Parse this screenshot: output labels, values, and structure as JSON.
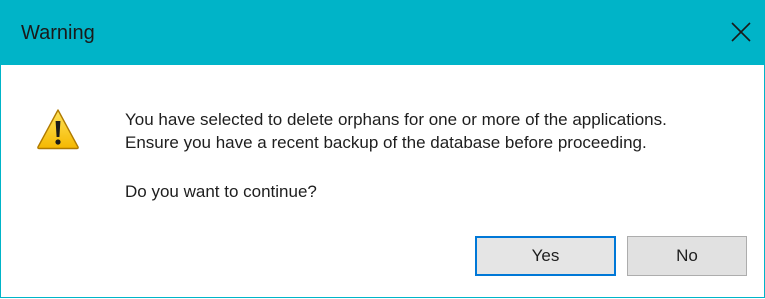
{
  "window": {
    "title": "Warning",
    "close_icon": "close-icon",
    "titlebar_color": "#00b4c8"
  },
  "message": {
    "icon": "warning-triangle-icon",
    "line1": "You have selected to delete orphans for one or more of the applications.",
    "line2": "Ensure you have a recent backup of the database before proceeding.",
    "question": "Do you want to continue?"
  },
  "buttons": {
    "yes_label": "Yes",
    "no_label": "No",
    "default": "Yes",
    "focus_color": "#0078d7"
  }
}
